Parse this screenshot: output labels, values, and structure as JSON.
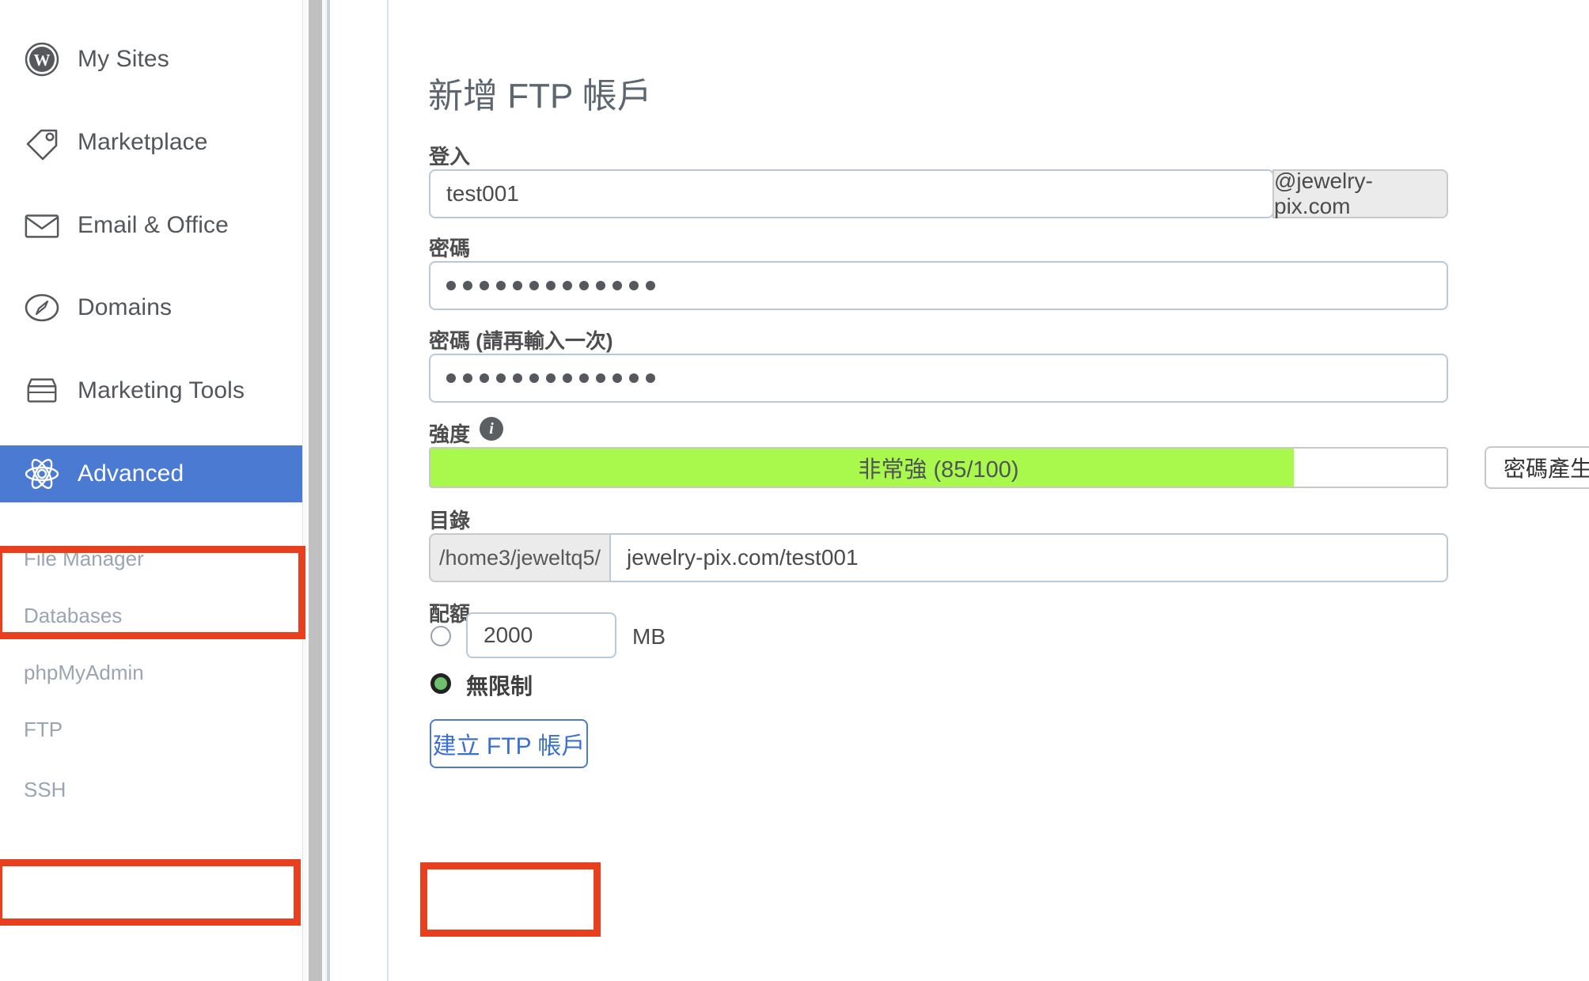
{
  "sidebar": {
    "main_items": [
      {
        "label": "My Sites",
        "icon": "wordpress-icon"
      },
      {
        "label": "Marketplace",
        "icon": "tag-icon"
      },
      {
        "label": "Email & Office",
        "icon": "envelope-icon"
      },
      {
        "label": "Domains",
        "icon": "compass-icon"
      },
      {
        "label": "Marketing Tools",
        "icon": "storefront-icon"
      },
      {
        "label": "Advanced",
        "icon": "atom-icon"
      }
    ],
    "active_item": "Advanced",
    "sub_items": [
      {
        "label": "File Manager"
      },
      {
        "label": "Databases"
      },
      {
        "label": "phpMyAdmin"
      },
      {
        "label": "FTP"
      },
      {
        "label": "SSH"
      }
    ],
    "highlighted_sub_item": "FTP",
    "accent_active": "#4a7ad1",
    "annotation_color": "#e8401f"
  },
  "main": {
    "title": "新增 FTP 帳戶",
    "login": {
      "label": "登入",
      "value": "test001",
      "domain_suffix": "@jewelry-pix.com"
    },
    "password": {
      "label": "密碼",
      "masked_char_count": 13
    },
    "password_confirm": {
      "label": "密碼 (請再輸入一次)",
      "masked_char_count": 13
    },
    "strength": {
      "label": "強度",
      "info_icon": "info-icon",
      "text": "非常強 (85/100)",
      "score": 85,
      "max": 100,
      "fill_color": "#a9f94d",
      "generator_button": "密碼產生器"
    },
    "directory": {
      "label": "目錄",
      "prefix": "/home3/jeweltq5/",
      "value": "jewelry-pix.com/test001"
    },
    "quota": {
      "label": "配額",
      "value": "2000",
      "unit": "MB",
      "unlimited_label": "無限制",
      "selected": "unlimited"
    },
    "submit_button": "建立 FTP 帳戶"
  }
}
